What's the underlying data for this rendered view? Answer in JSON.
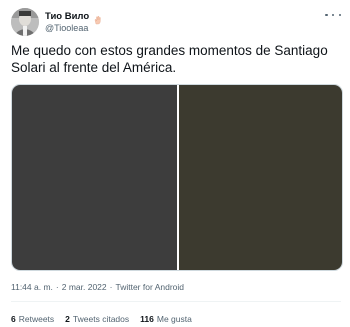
{
  "author": {
    "display_name": "Тио Вило",
    "handle": "@Tiooleaa",
    "badge_icon": "hand-emoji-icon"
  },
  "tweet": {
    "text": "Me quedo con estos grandes momentos de Santiago Solari al frente del América.",
    "media": {
      "left_color": "#3d3d3d",
      "right_color": "#3c3a2f"
    }
  },
  "meta": {
    "time": "11:44 a. m.",
    "separator1": "·",
    "date": "2 mar. 2022",
    "separator2": "·",
    "source": "Twitter for Android"
  },
  "stats": {
    "retweets_count": "6",
    "retweets_label": "Retweets",
    "quotes_count": "2",
    "quotes_label": "Tweets citados",
    "likes_count": "116",
    "likes_label": "Me gusta"
  },
  "colors": {
    "text_primary": "#0f1419",
    "text_secondary": "#536471",
    "divider": "#eff3f4"
  }
}
